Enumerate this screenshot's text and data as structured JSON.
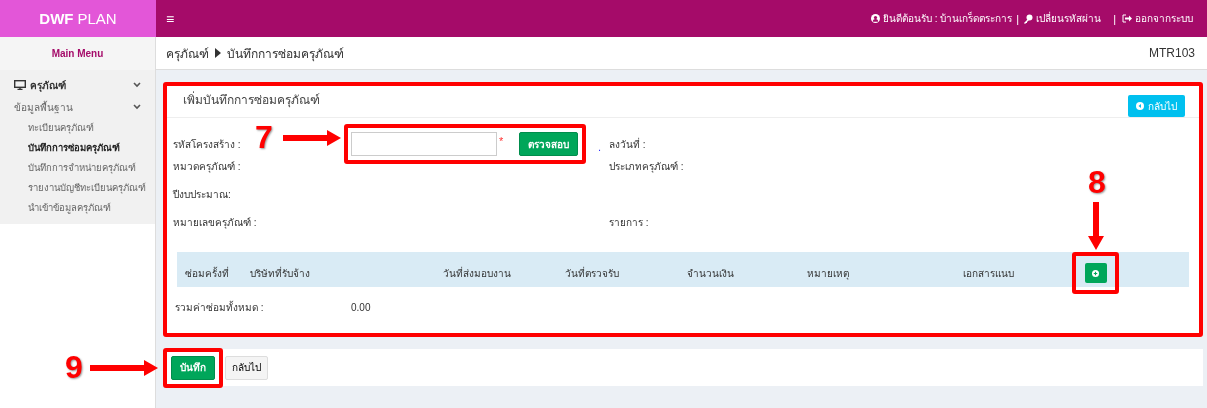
{
  "brand": {
    "bold": "DWF",
    "rest": "PLAN"
  },
  "topbar": {
    "menu": "≡",
    "welcome": "ยินดีต้อนรับ : บ้านเกร็ดตระการ",
    "change_password": "เปลี่ยนรหัสผ่าน",
    "logout": "ออกจากระบบ",
    "separators": [
      "|",
      "|"
    ]
  },
  "sidebar": {
    "title": "Main Menu",
    "section": {
      "label": "ครุภัณฑ์",
      "expanded": true
    },
    "subsection": {
      "label": "ข้อมูลพื้นฐาน",
      "expanded": true
    },
    "items": [
      {
        "label": "ทะเบียนครุภัณฑ์",
        "selected": false
      },
      {
        "label": "บันทึกการซ่อมครุภัณฑ์",
        "selected": true
      },
      {
        "label": "บันทึกการจำหน่ายครุภัณฑ์",
        "selected": false
      },
      {
        "label": "รายงานบัญชีทะเบียนครุภัณฑ์",
        "selected": false
      },
      {
        "label": "นำเข้าข้อมูลครุภัณฑ์",
        "selected": false
      }
    ]
  },
  "breadcrumb": {
    "parent": "ครุภัณฑ์",
    "current": "บันทึกการซ่อมครุภัณฑ์",
    "code": "MTR103"
  },
  "form": {
    "title": "เพิ่มบันทึกการซ่อมครุภัณฑ์",
    "back_button": "กลับไป",
    "rows": [
      {
        "kind": "input",
        "label": "รหัสโครงสร้าง :",
        "required": "*",
        "button": "ตรวจสอบ",
        "dot": ".",
        "right": "ลงวันที่ :"
      },
      {
        "kind": "text",
        "label": "หมวดครุภัณฑ์ :",
        "right": "ประเภทครุภัณฑ์ :"
      },
      {
        "kind": "text",
        "label": "ปีงบประมาณ:"
      },
      {
        "kind": "text",
        "label": "หมายเลขครุภัณฑ์ :",
        "right": "รายการ :"
      }
    ],
    "columns": [
      "ซ่อมครั้งที่",
      "บริษัทที่รับจ้าง",
      "วันที่ส่งมอบงาน",
      "วันที่ตรวจรับ",
      "จำนวนเงิน",
      "หมายเหตุ",
      "เอกสารแนบ"
    ],
    "total": {
      "label": "รวมค่าซ่อมทั้งหมด :",
      "value": "0.00"
    }
  },
  "footer": {
    "save": "บันทึก",
    "back": "กลับไป"
  },
  "callouts": [
    "7",
    "8",
    "9"
  ]
}
